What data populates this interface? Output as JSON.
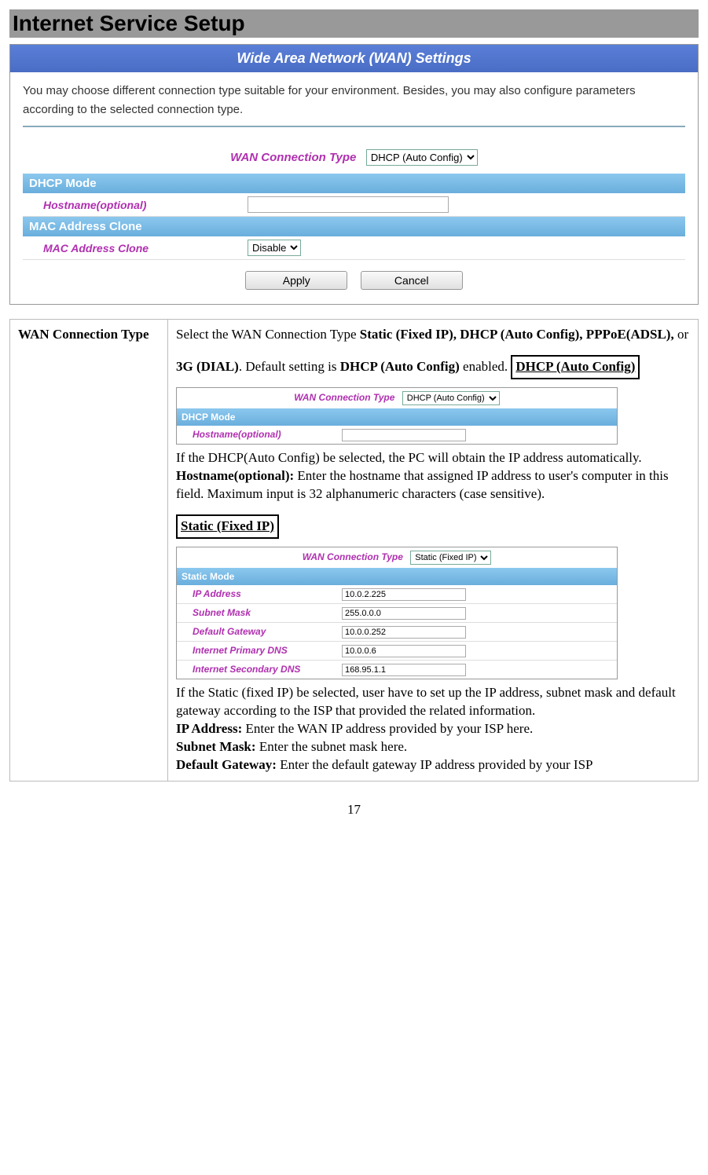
{
  "page_title": "Internet Service Setup",
  "panel": {
    "header": "Wide Area Network (WAN) Settings",
    "intro": "You may choose different connection type suitable for your environment. Besides, you may also configure parameters according to the selected connection type.",
    "wan_label": "WAN Connection Type",
    "wan_value": "DHCP (Auto Config)",
    "dhcp_mode_header": "DHCP Mode",
    "hostname_label": "Hostname(optional)",
    "hostname_value": "",
    "mac_header": "MAC Address Clone",
    "mac_label": "MAC Address Clone",
    "mac_value": "Disable",
    "apply": "Apply",
    "cancel": "Cancel"
  },
  "table": {
    "left": "WAN Connection Type",
    "p1_pre": "Select the WAN Connection Type ",
    "p1_b1": "Static (Fixed IP), DHCP (Auto Config), PPPoE(ADSL),",
    "p1_mid": " or ",
    "p1_b2": "3G (DIAL)",
    "p1_mid2": ". Default setting is ",
    "p1_b3": "DHCP (Auto Config)",
    "p1_post": " enabled.",
    "dhcp_heading": "DHCP (Auto Config)",
    "mini_dhcp": {
      "wan_label": "WAN Connection Type",
      "wan_value": "DHCP (Auto Config)",
      "header": "DHCP Mode",
      "hostname_label": "Hostname(optional)",
      "hostname_value": ""
    },
    "dhcp_desc": "If the DHCP(Auto Config) be selected, the PC will obtain the IP address automatically.",
    "hostname_b": "Hostname(optional):",
    "hostname_desc": " Enter the hostname that assigned IP address to user's computer in this field. Maximum input is 32 alphanumeric characters (case sensitive).",
    "static_heading": "Static (Fixed IP)",
    "mini_static": {
      "wan_label": "WAN Connection Type",
      "wan_value": "Static (Fixed IP)",
      "header": "Static Mode",
      "rows": [
        {
          "label": "IP Address",
          "value": "10.0.2.225"
        },
        {
          "label": "Subnet Mask",
          "value": "255.0.0.0"
        },
        {
          "label": "Default Gateway",
          "value": "10.0.0.252"
        },
        {
          "label": "Internet Primary DNS",
          "value": "10.0.0.6"
        },
        {
          "label": "Internet Secondary DNS",
          "value": "168.95.1.1"
        }
      ]
    },
    "static_desc": "If the Static (fixed IP) be selected, user have to set up the IP address, subnet mask and default gateway according to the ISP that provided the related information.",
    "ip_b": "IP Address:",
    "ip_desc": " Enter the WAN IP address provided by your ISP here.",
    "sm_b": "Subnet Mask:",
    "sm_desc": " Enter the subnet mask here.",
    "gw_b": "Default Gateway:",
    "gw_desc": " Enter the default gateway IP address provided by your ISP"
  },
  "page_number": "17"
}
